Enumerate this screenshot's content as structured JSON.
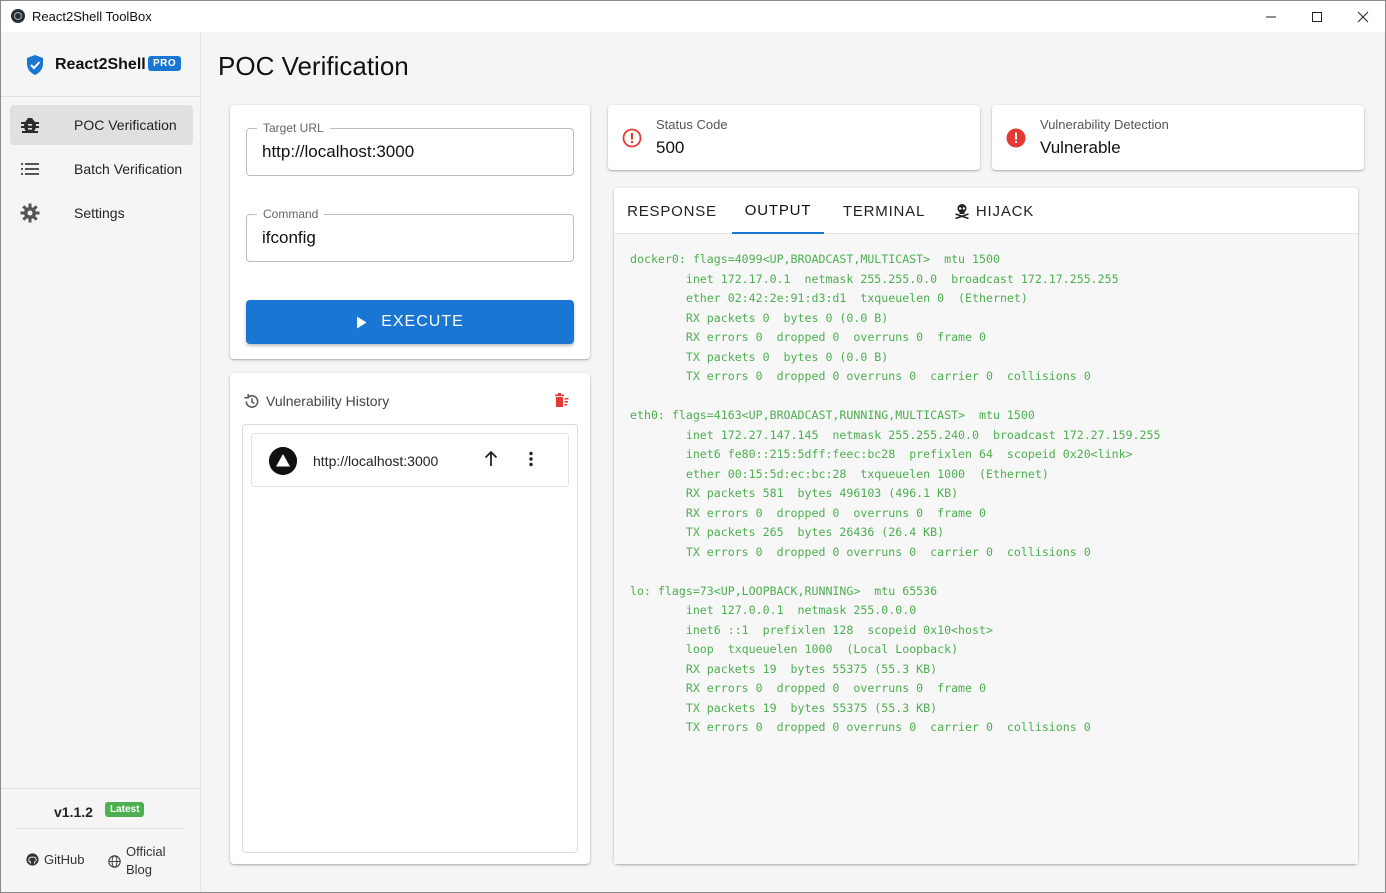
{
  "window": {
    "title": "React2Shell ToolBox"
  },
  "sidebar": {
    "brand": "React2Shell",
    "badge": "PRO",
    "items": [
      {
        "label": "POC Verification",
        "icon": "bug-icon"
      },
      {
        "label": "Batch Verification",
        "icon": "list-icon"
      },
      {
        "label": "Settings",
        "icon": "gear-icon"
      }
    ],
    "version": "v1.1.2",
    "version_badge": "Latest",
    "links": {
      "github": "GitHub",
      "blog": "Official Blog"
    }
  },
  "page": {
    "title": "POC Verification"
  },
  "form": {
    "target_url_label": "Target URL",
    "target_url_value": "http://localhost:3000",
    "command_label": "Command",
    "command_value": "ifconfig",
    "execute_label": "EXECUTE"
  },
  "history": {
    "title": "Vulnerability History",
    "items": [
      {
        "url": "http://localhost:3000"
      }
    ]
  },
  "status": {
    "code_label": "Status Code",
    "code_value": "500",
    "detection_label": "Vulnerability Detection",
    "detection_value": "Vulnerable"
  },
  "tabs": [
    "RESPONSE",
    "OUTPUT",
    "TERMINAL",
    "HIJACK"
  ],
  "output": "docker0: flags=4099<UP,BROADCAST,MULTICAST>  mtu 1500\n        inet 172.17.0.1  netmask 255.255.0.0  broadcast 172.17.255.255\n        ether 02:42:2e:91:d3:d1  txqueuelen 0  (Ethernet)\n        RX packets 0  bytes 0 (0.0 B)\n        RX errors 0  dropped 0  overruns 0  frame 0\n        TX packets 0  bytes 0 (0.0 B)\n        TX errors 0  dropped 0 overruns 0  carrier 0  collisions 0\n\neth0: flags=4163<UP,BROADCAST,RUNNING,MULTICAST>  mtu 1500\n        inet 172.27.147.145  netmask 255.255.240.0  broadcast 172.27.159.255\n        inet6 fe80::215:5dff:feec:bc28  prefixlen 64  scopeid 0x20<link>\n        ether 00:15:5d:ec:bc:28  txqueuelen 1000  (Ethernet)\n        RX packets 581  bytes 496103 (496.1 KB)\n        RX errors 0  dropped 0  overruns 0  frame 0\n        TX packets 265  bytes 26436 (26.4 KB)\n        TX errors 0  dropped 0 overruns 0  carrier 0  collisions 0\n\nlo: flags=73<UP,LOOPBACK,RUNNING>  mtu 65536\n        inet 127.0.0.1  netmask 255.0.0.0\n        inet6 ::1  prefixlen 128  scopeid 0x10<host>\n        loop  txqueuelen 1000  (Local Loopback)\n        RX packets 19  bytes 55375 (55.3 KB)\n        RX errors 0  dropped 0  overruns 0  frame 0\n        TX packets 19  bytes 55375 (55.3 KB)\n        TX errors 0  dropped 0 overruns 0  carrier 0  collisions 0",
  "colors": {
    "accent": "#1976d2",
    "error": "#e53935",
    "output_text": "#4caf50",
    "latest": "#4caf50"
  }
}
